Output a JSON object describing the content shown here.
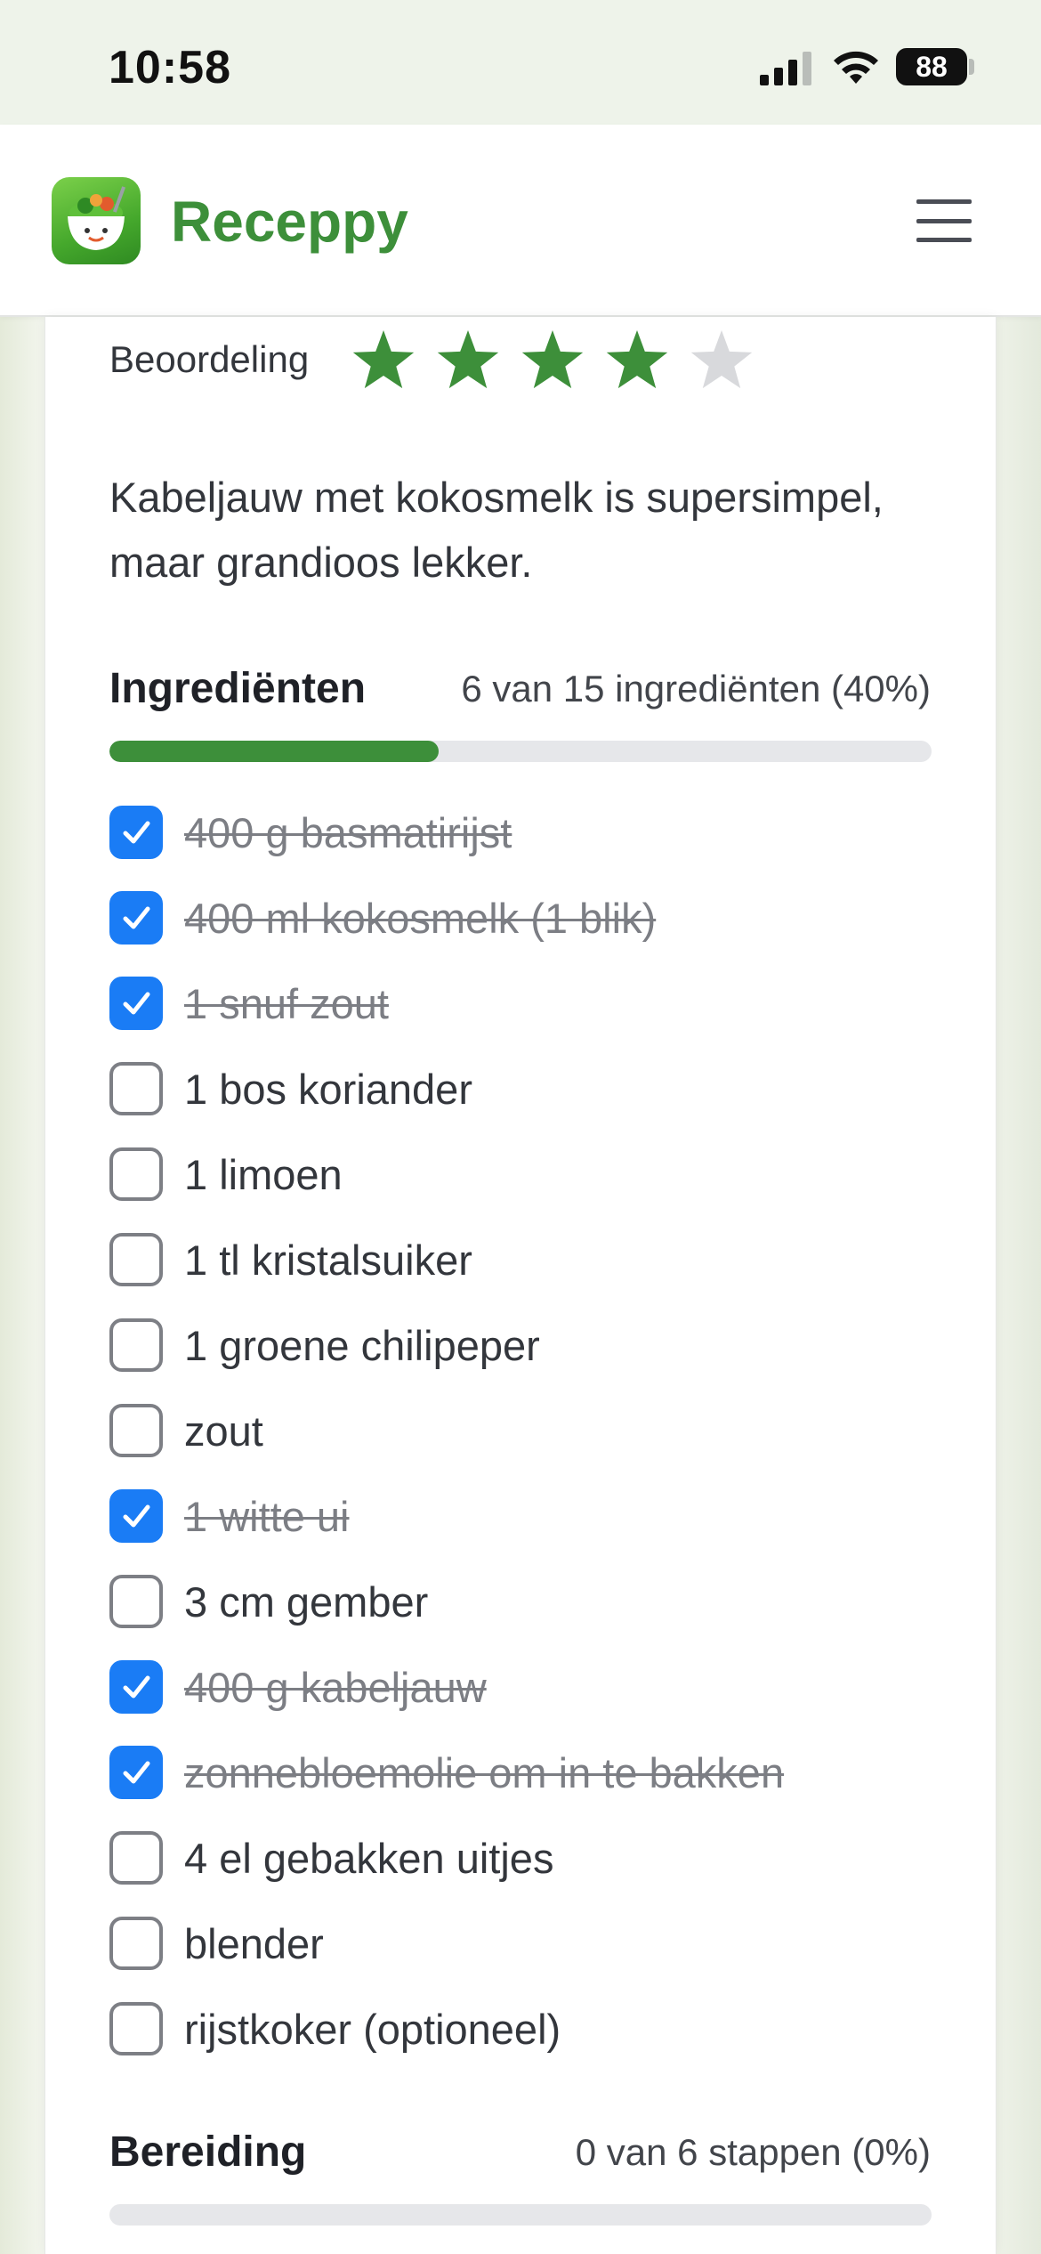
{
  "status_bar": {
    "time": "10:58",
    "battery": "88",
    "icons": [
      "signal-icon",
      "wifi-icon",
      "battery-icon"
    ]
  },
  "header": {
    "app_name": "Receppy",
    "logo_icon": "salad-bowl-logo-icon",
    "menu_icon": "hamburger-menu-icon"
  },
  "rating": {
    "label": "Beoordeling",
    "value": 4,
    "max": 5,
    "star_color": "#3d8f3a",
    "empty_star_color": "#d8d9dc"
  },
  "description": "Kabeljauw met kokosmelk is supersimpel, maar grandioos lekker.",
  "ingredients": {
    "title": "Ingrediënten",
    "progress_text": "6 van 15 ingrediënten (40%)",
    "progress_fraction": 0.4,
    "items": [
      {
        "label": "400 g basmatirijst",
        "checked": true
      },
      {
        "label": "400 ml kokosmelk (1 blik)",
        "checked": true
      },
      {
        "label": "1 snuf zout",
        "checked": true
      },
      {
        "label": "1 bos koriander",
        "checked": false
      },
      {
        "label": "1 limoen",
        "checked": false
      },
      {
        "label": "1 tl kristalsuiker",
        "checked": false
      },
      {
        "label": "1 groene chilipeper",
        "checked": false
      },
      {
        "label": "zout",
        "checked": false
      },
      {
        "label": "1 witte ui",
        "checked": true
      },
      {
        "label": "3 cm gember",
        "checked": false
      },
      {
        "label": "400 g kabeljauw",
        "checked": true
      },
      {
        "label": "zonnebloemolie om in te bakken",
        "checked": true
      },
      {
        "label": "4 el gebakken uitjes",
        "checked": false
      },
      {
        "label": "blender",
        "checked": false
      },
      {
        "label": "rijstkoker (optioneel)",
        "checked": false
      }
    ]
  },
  "preparation": {
    "title": "Bereiding",
    "progress_text": "0 van 6 stappen (0%)",
    "progress_fraction": 0
  },
  "colors": {
    "brand_green": "#3d8f3a",
    "checkbox_blue": "#1a7cf5"
  }
}
